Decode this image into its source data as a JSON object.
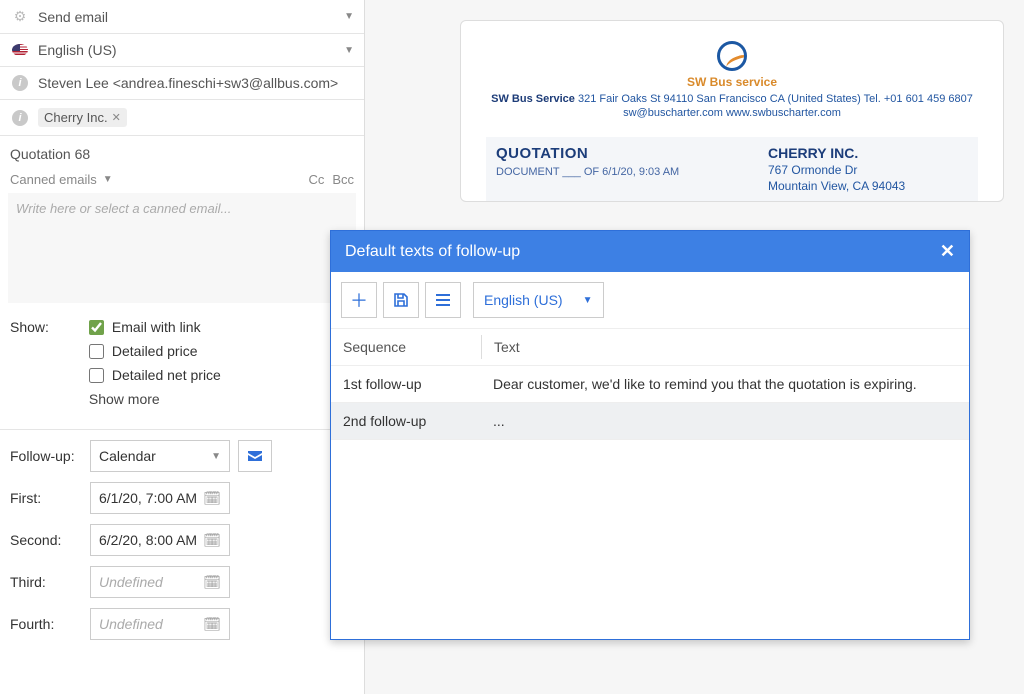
{
  "left": {
    "send_email_label": "Send email",
    "language_label": "English (US)",
    "recipient": "Steven Lee <andrea.fineschi+sw3@allbus.com>",
    "company_tag": "Cherry Inc.",
    "subject": "Quotation 68",
    "canned_label": "Canned emails",
    "cc": "Cc",
    "bcc": "Bcc",
    "editor_placeholder": "Write here or select a canned email...",
    "show_label": "Show:",
    "opt_email_link": "Email with link",
    "opt_detailed_price": "Detailed price",
    "opt_detailed_net": "Detailed net price",
    "show_more": "Show more"
  },
  "followup": {
    "label": "Follow-up:",
    "select_value": "Calendar",
    "first_label": "First:",
    "first_value": "6/1/20, 7:00 AM",
    "second_label": "Second:",
    "second_value": "6/2/20, 8:00 AM",
    "third_label": "Third:",
    "third_placeholder": "Undefined",
    "fourth_label": "Fourth:",
    "fourth_placeholder": "Undefined"
  },
  "doc": {
    "brand": "SW Bus service",
    "company_name": "SW Bus Service",
    "company_address": "321 Fair Oaks St 94110 San Francisco CA (United States) Tel. +01 601 459 6807",
    "company_contact": "sw@buscharter.com www.swbuscharter.com",
    "quotation_title": "QUOTATION",
    "quotation_sub": "DOCUMENT ___ OF 6/1/20, 9:03 AM",
    "customer_name": "CHERRY INC.",
    "customer_addr1": "767 Ormonde Dr",
    "customer_addr2": "Mountain View, CA 94043"
  },
  "modal": {
    "title": "Default texts of follow-up",
    "lang": "English (US)",
    "col_seq": "Sequence",
    "col_text": "Text",
    "rows": [
      {
        "seq": "1st follow-up",
        "text": "Dear customer, we'd like to remind you that the quotation is expiring."
      },
      {
        "seq": "2nd follow-up",
        "text": "..."
      }
    ]
  }
}
